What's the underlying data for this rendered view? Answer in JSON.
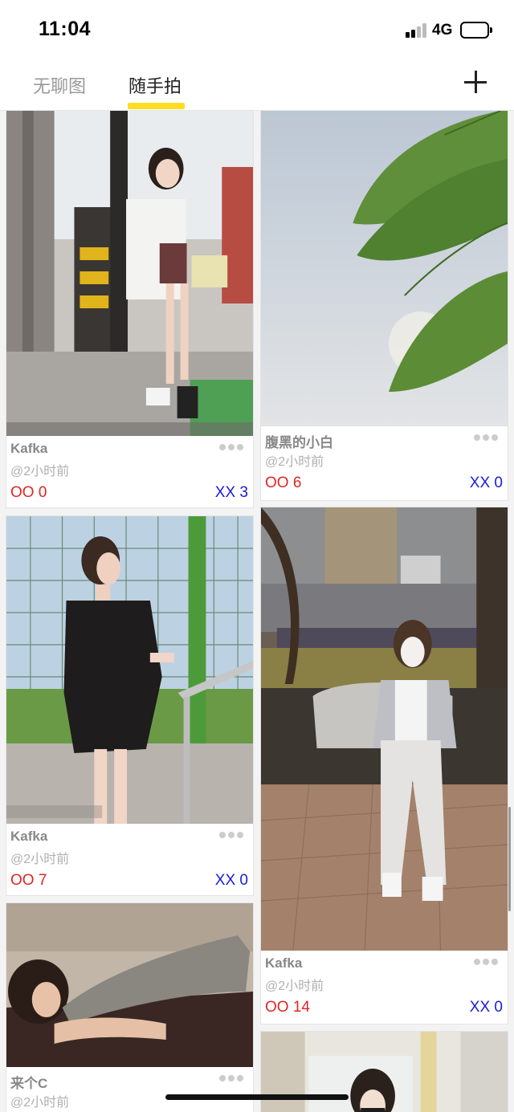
{
  "status_bar": {
    "time": "11:04",
    "network": "4G"
  },
  "nav": {
    "tabs": [
      {
        "label": "无聊图",
        "active": false
      },
      {
        "label": "随手拍",
        "active": true
      }
    ],
    "accent_color": "#ffdd22"
  },
  "feed": {
    "cards": [
      {
        "author": "Kafka",
        "time": "@2小时前",
        "oo": "OO  0",
        "xx": "XX  3"
      },
      {
        "author": "腹黑的小白",
        "time": "@2小时前",
        "oo": "OO  6",
        "xx": "XX  0"
      },
      {
        "author": "Kafka",
        "time": "@2小时前",
        "oo": "OO  7",
        "xx": "XX  0"
      },
      {
        "author": "Kafka",
        "time": "@2小时前",
        "oo": "OO  14",
        "xx": "XX  0"
      },
      {
        "author": "来个C",
        "time": "@2小时前",
        "oo": "",
        "xx": ""
      }
    ]
  },
  "colors": {
    "oo": "#e02525",
    "xx": "#1a1ae0"
  }
}
